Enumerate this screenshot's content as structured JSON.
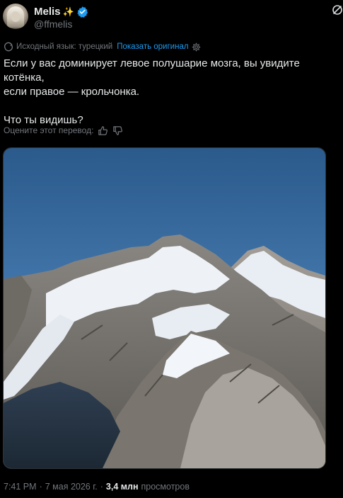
{
  "author": {
    "display_name": "Melis",
    "emoji": "✨",
    "handle": "@ffmelis",
    "verified": true
  },
  "translation": {
    "source_label": "Исходный язык: турецкий",
    "show_original": "Показать оригинал"
  },
  "tweet": {
    "line1": "Если у вас доминирует левое полушарие мозга, вы увидите котёнка,",
    "line2": "если правое — крольчонка.",
    "line3": "Что ты видишь?"
  },
  "rate": {
    "label": "Оцените этот перевод:"
  },
  "media": {
    "icon": "mountain-photo"
  },
  "meta": {
    "time": "7:41 PM",
    "date": "7 мая 2026 г.",
    "separator": "·",
    "views_count": "3,4 млн",
    "views_label": "просмотров"
  },
  "colors": {
    "background": "#000000",
    "text": "#e7e9ea",
    "muted": "#71767b",
    "accent": "#1d9bf0",
    "sparkle": "#ffd43b"
  }
}
